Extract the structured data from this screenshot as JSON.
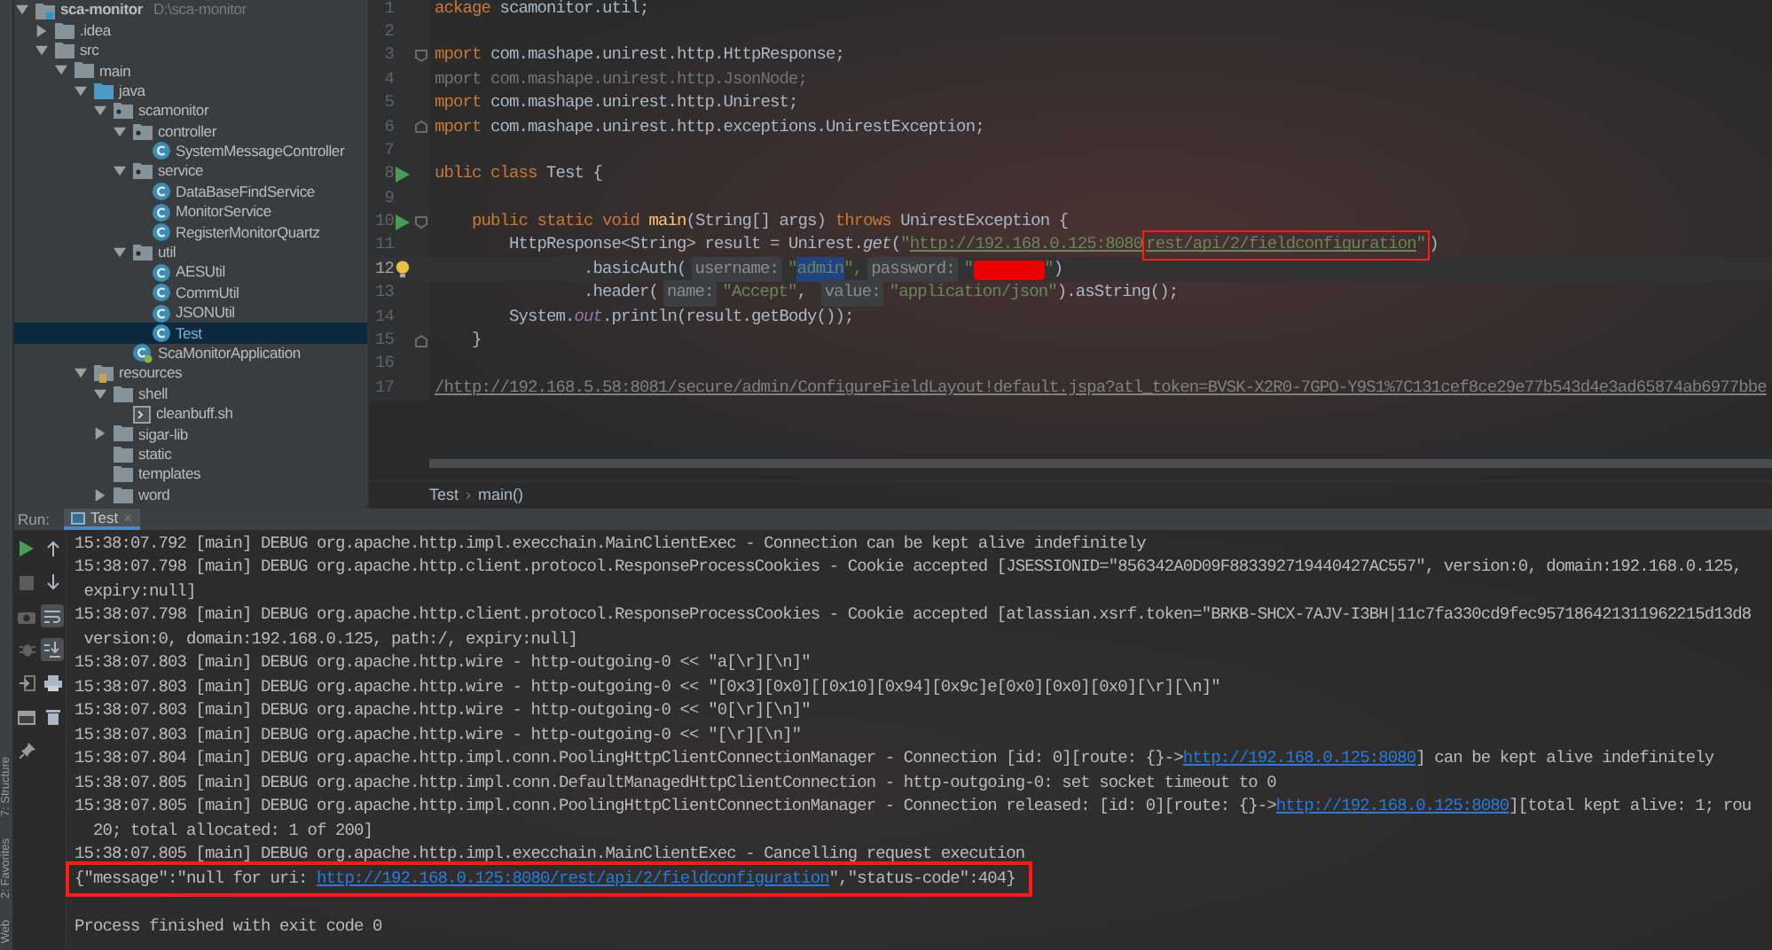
{
  "project_tree": {
    "name": "sca-monitor",
    "path": "D:\\sca-monitor",
    "kind": "module",
    "expanded": true,
    "selected": false,
    "children": [
      {
        "name": ".idea",
        "kind": "folder",
        "expanded": false,
        "selected": false
      },
      {
        "name": "src",
        "kind": "folder",
        "expanded": true,
        "selected": false,
        "children": [
          {
            "name": "main",
            "kind": "folder",
            "expanded": true,
            "selected": false,
            "children": [
              {
                "name": "java",
                "kind": "source_folder",
                "expanded": true,
                "selected": false,
                "children": [
                  {
                    "name": "scamonitor",
                    "kind": "package",
                    "expanded": true,
                    "selected": false,
                    "children": [
                      {
                        "name": "controller",
                        "kind": "package",
                        "expanded": true,
                        "selected": false,
                        "children": [
                          {
                            "name": "SystemMessageController",
                            "kind": "class",
                            "selected": false
                          }
                        ]
                      },
                      {
                        "name": "service",
                        "kind": "package",
                        "expanded": true,
                        "selected": false,
                        "children": [
                          {
                            "name": "DataBaseFindService",
                            "kind": "class",
                            "selected": false
                          },
                          {
                            "name": "MonitorService",
                            "kind": "class",
                            "selected": false
                          },
                          {
                            "name": "RegisterMonitorQuartz",
                            "kind": "class",
                            "selected": false
                          }
                        ]
                      },
                      {
                        "name": "util",
                        "kind": "package",
                        "expanded": true,
                        "selected": false,
                        "children": [
                          {
                            "name": "AESUtil",
                            "kind": "class",
                            "selected": false
                          },
                          {
                            "name": "CommUtil",
                            "kind": "class",
                            "selected": false
                          },
                          {
                            "name": "JSONUtil",
                            "kind": "class",
                            "selected": false
                          },
                          {
                            "name": "Test",
                            "kind": "class",
                            "selected": true
                          }
                        ]
                      },
                      {
                        "name": "ScaMonitorApplication",
                        "kind": "app_class",
                        "selected": false
                      }
                    ]
                  }
                ]
              },
              {
                "name": "resources",
                "kind": "resources_folder",
                "expanded": true,
                "selected": false,
                "children": [
                  {
                    "name": "shell",
                    "kind": "folder",
                    "expanded": true,
                    "selected": false,
                    "children": [
                      {
                        "name": "cleanbuff.sh",
                        "kind": "script",
                        "selected": false
                      }
                    ]
                  },
                  {
                    "name": "sigar-lib",
                    "kind": "folder",
                    "expanded": false,
                    "selected": false
                  },
                  {
                    "name": "static",
                    "kind": "folder",
                    "selected": false
                  },
                  {
                    "name": "templates",
                    "kind": "folder",
                    "selected": false
                  },
                  {
                    "name": "word",
                    "kind": "folder",
                    "expanded": false,
                    "selected": false
                  }
                ]
              }
            ]
          }
        ]
      }
    ]
  },
  "editor": {
    "lines": [
      {
        "number": "1",
        "current": false,
        "run_icon": false,
        "bulb": false,
        "fold_start": false,
        "fold_end": false,
        "segments": [
          {
            "kind": "kw",
            "text": "ackage "
          },
          {
            "kind": "plain",
            "text": "scamonitor.util;"
          }
        ]
      },
      {
        "number": "2",
        "current": false,
        "run_icon": false,
        "bulb": false,
        "fold_start": false,
        "fold_end": false
      },
      {
        "number": "3",
        "current": false,
        "run_icon": false,
        "bulb": false,
        "fold_start": true,
        "fold_end": false,
        "segments": [
          {
            "kind": "kw",
            "text": "mport "
          },
          {
            "kind": "plain",
            "text": "com.mashape.unirest.http.HttpResponse;"
          }
        ]
      },
      {
        "number": "4",
        "current": false,
        "run_icon": false,
        "bulb": false,
        "fold_start": false,
        "fold_end": false,
        "segments": [
          {
            "kind": "dim",
            "text": "mport com.mashape.unirest.http.JsonNode;"
          }
        ]
      },
      {
        "number": "5",
        "current": false,
        "run_icon": false,
        "bulb": false,
        "fold_start": false,
        "fold_end": false,
        "segments": [
          {
            "kind": "kw",
            "text": "mport "
          },
          {
            "kind": "plain",
            "text": "com.mashape.unirest.http.Unirest;"
          }
        ]
      },
      {
        "number": "6",
        "current": false,
        "run_icon": false,
        "bulb": false,
        "fold_start": false,
        "fold_end": true,
        "segments": [
          {
            "kind": "kw",
            "text": "mport "
          },
          {
            "kind": "plain",
            "text": "com.mashape.unirest.http.exceptions.UnirestException;"
          }
        ]
      },
      {
        "number": "7",
        "current": false,
        "run_icon": false,
        "bulb": false,
        "fold_start": false,
        "fold_end": false
      },
      {
        "number": "8",
        "current": false,
        "run_icon": true,
        "bulb": false,
        "fold_start": false,
        "fold_end": false,
        "segments": [
          {
            "kind": "kw",
            "text": "ublic class "
          },
          {
            "kind": "plain",
            "text": "Test {"
          }
        ]
      },
      {
        "number": "9",
        "current": false,
        "run_icon": false,
        "bulb": false,
        "fold_start": false,
        "fold_end": false
      },
      {
        "number": "10",
        "current": false,
        "run_icon": true,
        "bulb": false,
        "fold_start": true,
        "fold_end": false,
        "segments": [
          {
            "kind": "kw",
            "text": "    public static void "
          },
          {
            "kind": "fn",
            "text": "main"
          },
          {
            "kind": "plain",
            "text": "(String[] args) "
          },
          {
            "kind": "kw",
            "text": "throws "
          },
          {
            "kind": "plain",
            "text": "UnirestException {"
          }
        ]
      },
      {
        "number": "11",
        "current": false,
        "run_icon": false,
        "bulb": false,
        "fold_start": false,
        "fold_end": false,
        "segments": [
          {
            "kind": "plain",
            "text": "        HttpResponse<String> result = Unirest."
          },
          {
            "kind": "italic",
            "text": "get"
          },
          {
            "kind": "plain",
            "text": "("
          },
          {
            "kind": "str",
            "text": "\""
          },
          {
            "kind": "url",
            "text": "http://192.168.0.125:8080"
          },
          {
            "kind": "boxed",
            "parts": [
              {
                "kind": "url",
                "text": "rest/api/2/fieldconfiguration"
              },
              {
                "kind": "str",
                "text": "\""
              }
            ]
          },
          {
            "kind": "plain",
            "text": ")"
          }
        ]
      },
      {
        "number": "12",
        "current": true,
        "run_icon": false,
        "bulb": true,
        "fold_start": false,
        "fold_end": false,
        "segments": [
          {
            "kind": "plain",
            "text": "                .basicAuth("
          },
          {
            "kind": "hint",
            "text": "username:"
          },
          {
            "kind": "str",
            "text": "\""
          },
          {
            "kind": "sel",
            "text": "admin"
          },
          {
            "kind": "str",
            "text": "\","
          },
          {
            "kind": "hint",
            "text": "password:"
          },
          {
            "kind": "str",
            "text": "\""
          },
          {
            "kind": "redacted"
          },
          {
            "kind": "str",
            "text": "\""
          },
          {
            "kind": "plain",
            "text": ")"
          }
        ]
      },
      {
        "number": "13",
        "current": false,
        "run_icon": false,
        "bulb": false,
        "fold_start": false,
        "fold_end": false,
        "segments": [
          {
            "kind": "plain",
            "text": "                .header("
          },
          {
            "kind": "hint",
            "text": "name:"
          },
          {
            "kind": "str",
            "text": "\"Accept\""
          },
          {
            "kind": "plain",
            "text": ", "
          },
          {
            "kind": "hint",
            "text": "value:"
          },
          {
            "kind": "str",
            "text": "\"application/json\""
          },
          {
            "kind": "plain",
            "text": ").asString();"
          }
        ]
      },
      {
        "number": "14",
        "current": false,
        "run_icon": false,
        "bulb": false,
        "fold_start": false,
        "fold_end": false,
        "segments": [
          {
            "kind": "plain",
            "text": "        System."
          },
          {
            "kind": "static",
            "text": "out"
          },
          {
            "kind": "plain",
            "text": ".println(result.getBody());"
          }
        ]
      },
      {
        "number": "15",
        "current": false,
        "run_icon": false,
        "bulb": false,
        "fold_start": false,
        "fold_end": true,
        "segments": [
          {
            "kind": "plain",
            "text": "    }"
          }
        ]
      },
      {
        "number": "16",
        "current": false,
        "run_icon": false,
        "bulb": false,
        "fold_start": false,
        "fold_end": false
      },
      {
        "number": "17",
        "current": false,
        "run_icon": false,
        "bulb": false,
        "fold_start": false,
        "fold_end": false,
        "segments": [
          {
            "kind": "comment",
            "text": "/http://192.168.5.58:8081/secure/admin/ConfigureFieldLayout!default.jspa?atl_token=BVSK-X2R0-7GPO-Y9S1%7C131cef8ce29e77b543d4e3ad65874ab6977bbe"
          }
        ]
      }
    ],
    "breadcrumbs": [
      {
        "text": "Test"
      },
      {
        "text": "main()"
      }
    ],
    "breadcrumb_separator": "›"
  },
  "run_panel": {
    "label": "Run:",
    "tabs": [
      {
        "title": "Test",
        "selected": true,
        "close": "×"
      }
    ],
    "toolbar": {
      "stop_enabled": false,
      "soft_wraps_on": true,
      "scroll_to_end_on": true
    },
    "console": [
      {
        "kind": "log",
        "segments": [
          {
            "kind": "text",
            "text": "15:38:07.792 [main] DEBUG org.apache.http.impl.execchain.MainClientExec - Connection can be kept alive indefinitely"
          }
        ]
      },
      {
        "kind": "log",
        "segments": [
          {
            "kind": "text",
            "text": "15:38:07.798 [main] DEBUG org.apache.http.client.protocol.ResponseProcessCookies - Cookie accepted [JSESSIONID=\"856342A0D09F883392719440427AC557\", version:0, domain:192.168.0.125,"
          }
        ]
      },
      {
        "kind": "log",
        "segments": [
          {
            "kind": "text",
            "text": " expiry:null]"
          }
        ]
      },
      {
        "kind": "log",
        "segments": [
          {
            "kind": "text",
            "text": "15:38:07.798 [main] DEBUG org.apache.http.client.protocol.ResponseProcessCookies - Cookie accepted [atlassian.xsrf.token=\"BRKB-SHCX-7AJV-I3BH|11c7fa330cd9fec957186421311962215d13d8"
          }
        ]
      },
      {
        "kind": "log",
        "segments": [
          {
            "kind": "text",
            "text": " version:0, domain:192.168.0.125, path:/, expiry:null]"
          }
        ]
      },
      {
        "kind": "log",
        "segments": [
          {
            "kind": "text",
            "text": "15:38:07.803 [main] DEBUG org.apache.http.wire - http-outgoing-0 << \"a[\\r][\\n]\""
          }
        ]
      },
      {
        "kind": "log",
        "segments": [
          {
            "kind": "text",
            "text": "15:38:07.803 [main] DEBUG org.apache.http.wire - http-outgoing-0 << \"[0x3][0x0][[0x10][0x94][0x9c]e[0x0][0x0][0x0][\\r][\\n]\""
          }
        ]
      },
      {
        "kind": "log",
        "segments": [
          {
            "kind": "text",
            "text": "15:38:07.803 [main] DEBUG org.apache.http.wire - http-outgoing-0 << \"0[\\r][\\n]\""
          }
        ]
      },
      {
        "kind": "log",
        "segments": [
          {
            "kind": "text",
            "text": "15:38:07.803 [main] DEBUG org.apache.http.wire - http-outgoing-0 << \"[\\r][\\n]\""
          }
        ]
      },
      {
        "kind": "log",
        "segments": [
          {
            "kind": "text",
            "text": "15:38:07.804 [main] DEBUG org.apache.http.impl.conn.PoolingHttpClientConnectionManager - Connection [id: 0][route: {}->"
          },
          {
            "kind": "link",
            "text": "http://192.168.0.125:8080"
          },
          {
            "kind": "text",
            "text": "] can be kept alive indefinitely"
          }
        ]
      },
      {
        "kind": "log",
        "segments": [
          {
            "kind": "text",
            "text": "15:38:07.805 [main] DEBUG org.apache.http.impl.conn.DefaultManagedHttpClientConnection - http-outgoing-0: set socket timeout to 0"
          }
        ]
      },
      {
        "kind": "log",
        "segments": [
          {
            "kind": "text",
            "text": "15:38:07.805 [main] DEBUG org.apache.http.impl.conn.PoolingHttpClientConnectionManager - Connection released: [id: 0][route: {}->"
          },
          {
            "kind": "link",
            "text": "http://192.168.0.125:8080"
          },
          {
            "kind": "text",
            "text": "][total kept alive: 1; rou"
          }
        ]
      },
      {
        "kind": "log",
        "segments": [
          {
            "kind": "text",
            "text": "  20; total allocated: 1 of 200]"
          }
        ]
      },
      {
        "kind": "log",
        "segments": [
          {
            "kind": "text",
            "text": "15:38:07.805 [main] DEBUG org.apache.http.impl.execchain.MainClientExec - Cancelling request execution"
          }
        ]
      },
      {
        "kind": "boxed",
        "segments": [
          {
            "kind": "text",
            "text": "{\"message\":\"null for uri: "
          },
          {
            "kind": "link",
            "text": "http://192.168.0.125:8080/rest/api/2/fieldconfiguration"
          },
          {
            "kind": "text",
            "text": "\",\"status-code\":404}"
          }
        ]
      },
      {
        "kind": "exit",
        "segments": [
          {
            "kind": "text",
            "text": "Process finished with exit code 0"
          }
        ]
      }
    ]
  },
  "tool_strip": [
    {
      "label": "7: Structure"
    },
    {
      "label": "2: Favorites"
    },
    {
      "label": "Web"
    }
  ]
}
